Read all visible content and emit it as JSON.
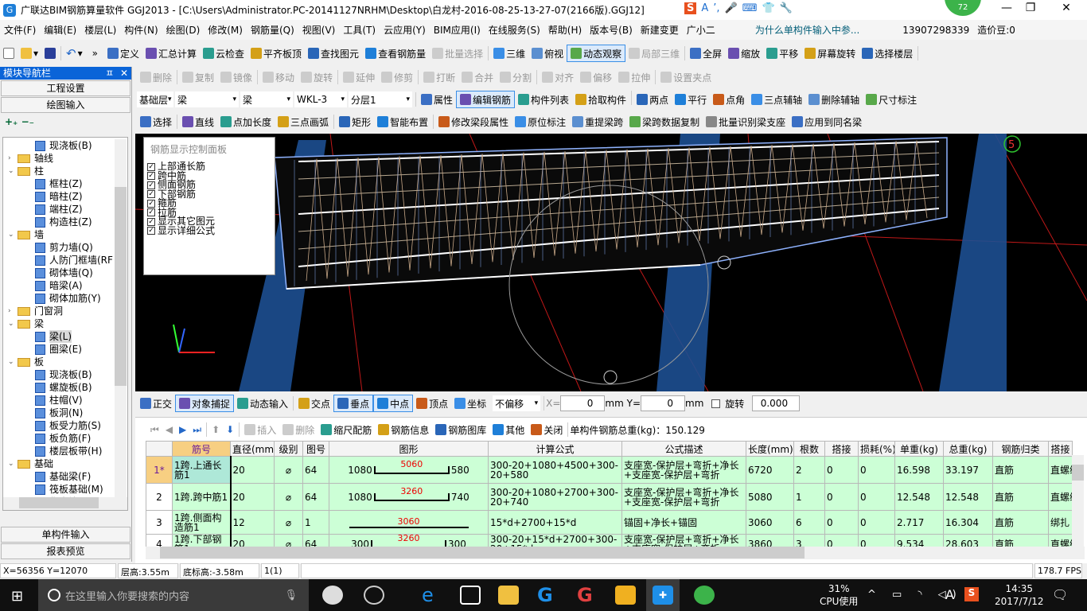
{
  "title": {
    "app_icon": "glodon-app-icon",
    "text": "广联达BIM钢筋算量软件 GGJ2013 - [C:\\Users\\Administrator.PC-20141127NRHM\\Desktop\\白龙村-2016-08-25-13-27-07(2166版).GGJ12]",
    "badge": "72",
    "ime": [
      "S",
      "A",
      "·,",
      "mic",
      "⌨",
      "15",
      "shirt",
      "wrench"
    ]
  },
  "menu": [
    "文件(F)",
    "编辑(E)",
    "楼层(L)",
    "构件(N)",
    "绘图(D)",
    "修改(M)",
    "钢筋量(Q)",
    "视图(V)",
    "工具(T)",
    "云应用(Y)",
    "BIM应用(I)",
    "在线服务(S)",
    "帮助(H)",
    "版本号(B)",
    "新建变更",
    "广小二",
    "为什么单构件输入中参...",
    "13907298339",
    "造价豆:0"
  ],
  "toolbar1": [
    "定义",
    "汇总计算",
    "云检查",
    "平齐板顶",
    "查找图元",
    "查看钢筋量",
    "批量选择",
    "三维",
    "俯视",
    "动态观察",
    "局部三维",
    "全屏",
    "缩放",
    "平移",
    "屏幕旋转",
    "选择楼层"
  ],
  "toolbar2": [
    "删除",
    "复制",
    "镜像",
    "移动",
    "旋转",
    "延伸",
    "修剪",
    "打断",
    "合并",
    "分割",
    "对齐",
    "偏移",
    "拉伸",
    "设置夹点"
  ],
  "toolbar3": {
    "combos": [
      "基础层",
      "梁",
      "梁",
      "WKL-3",
      "分层1"
    ],
    "buttons": [
      "属性",
      "编辑钢筋",
      "构件列表",
      "拾取构件",
      "两点",
      "平行",
      "点角",
      "三点辅轴",
      "删除辅轴",
      "尺寸标注"
    ]
  },
  "toolbar4": [
    "选择",
    "直线",
    "点加长度",
    "三点画弧",
    "矩形",
    "智能布置",
    "修改梁段属性",
    "原位标注",
    "重提梁跨",
    "梁跨数据复制",
    "批量识别梁支座",
    "应用到同名梁"
  ],
  "nav": {
    "title": "模块导航栏",
    "buttons": [
      "工程设置",
      "绘图输入"
    ],
    "bottom": [
      "单构件输入",
      "报表预览"
    ],
    "tree": [
      {
        "l": 2,
        "t": "现浇板(B)"
      },
      {
        "l": 1,
        "t": "轴线",
        "f": "c"
      },
      {
        "l": 1,
        "t": "柱",
        "f": "o"
      },
      {
        "l": 2,
        "t": "框柱(Z)"
      },
      {
        "l": 2,
        "t": "暗柱(Z)"
      },
      {
        "l": 2,
        "t": "端柱(Z)"
      },
      {
        "l": 2,
        "t": "构造柱(Z)"
      },
      {
        "l": 1,
        "t": "墙",
        "f": "o"
      },
      {
        "l": 2,
        "t": "剪力墙(Q)"
      },
      {
        "l": 2,
        "t": "人防门框墙(RF"
      },
      {
        "l": 2,
        "t": "砌体墙(Q)"
      },
      {
        "l": 2,
        "t": "暗梁(A)"
      },
      {
        "l": 2,
        "t": "砌体加筋(Y)"
      },
      {
        "l": 1,
        "t": "门窗洞",
        "f": "c"
      },
      {
        "l": 1,
        "t": "梁",
        "f": "o"
      },
      {
        "l": 2,
        "t": "梁(L)",
        "sel": true
      },
      {
        "l": 2,
        "t": "圈梁(E)"
      },
      {
        "l": 1,
        "t": "板",
        "f": "o"
      },
      {
        "l": 2,
        "t": "现浇板(B)"
      },
      {
        "l": 2,
        "t": "螺旋板(B)"
      },
      {
        "l": 2,
        "t": "柱帽(V)"
      },
      {
        "l": 2,
        "t": "板洞(N)"
      },
      {
        "l": 2,
        "t": "板受力筋(S)"
      },
      {
        "l": 2,
        "t": "板负筋(F)"
      },
      {
        "l": 2,
        "t": "楼层板带(H)"
      },
      {
        "l": 1,
        "t": "基础",
        "f": "o"
      },
      {
        "l": 2,
        "t": "基础梁(F)"
      },
      {
        "l": 2,
        "t": "筏板基础(M)"
      },
      {
        "l": 2,
        "t": "集水坑(K)"
      },
      {
        "l": 2,
        "t": "柱墩(Y)"
      }
    ]
  },
  "rebar_panel": {
    "title": "钢筋显示控制面板",
    "items": [
      "上部通长筋",
      "跨中筋",
      "侧面钢筋",
      "下部钢筋",
      "箍筋",
      "拉筋",
      "显示其它图元",
      "显示详细公式"
    ]
  },
  "viewport": {
    "axis_label": "5"
  },
  "snapbar": {
    "buttons": [
      "正交",
      "对象捕捉",
      "动态输入",
      "交点",
      "垂点",
      "中点",
      "顶点",
      "坐标"
    ],
    "offset": "不偏移",
    "x_label": "X=",
    "x": "0",
    "y_label": "Y=",
    "y": "0",
    "unit": "mm",
    "rotate": "旋转",
    "rotate_val": "0.000"
  },
  "rebar_toolbar": {
    "buttons": [
      "插入",
      "删除",
      "缩尺配筋",
      "钢筋信息",
      "钢筋图库",
      "其他",
      "关闭"
    ],
    "total": "单构件钢筋总重(kg)：150.129"
  },
  "table": {
    "headers": [
      "",
      "筋号",
      "直径(mm)",
      "级别",
      "图号",
      "图形",
      "计算公式",
      "公式描述",
      "长度(mm)",
      "根数",
      "搭接",
      "损耗(%)",
      "单重(kg)",
      "总重(kg)",
      "钢筋归类",
      "搭接"
    ],
    "rows": [
      {
        "rn": "1*",
        "name": "1跨.上通长筋1",
        "d": "20",
        "grade": "⌀",
        "fig": "64",
        "s": [
          "1080",
          "5060",
          "580"
        ],
        "formula": "300-20+1080+4500+300-20+580",
        "desc": "支座宽-保护层+弯折+净长+支座宽-保护层+弯折",
        "len": "6720",
        "n": "2",
        "lap": "0",
        "loss": "0",
        "uw": "16.598",
        "tw": "33.197",
        "cat": "直筋",
        "lt": "直螺纹"
      },
      {
        "rn": "2",
        "name": "1跨.跨中筋1",
        "d": "20",
        "grade": "⌀",
        "fig": "64",
        "s": [
          "1080",
          "3260",
          "740"
        ],
        "formula": "300-20+1080+2700+300-20+740",
        "desc": "支座宽-保护层+弯折+净长+支座宽-保护层+弯折",
        "len": "5080",
        "n": "1",
        "lap": "0",
        "loss": "0",
        "uw": "12.548",
        "tw": "12.548",
        "cat": "直筋",
        "lt": "直螺纹"
      },
      {
        "rn": "3",
        "name": "1跨.侧面构造筋1",
        "d": "12",
        "grade": "⌀",
        "fig": "1",
        "s": [
          "",
          "3060",
          ""
        ],
        "formula": "15*d+2700+15*d",
        "desc": "锚固+净长+锚固",
        "len": "3060",
        "n": "6",
        "lap": "0",
        "loss": "0",
        "uw": "2.717",
        "tw": "16.304",
        "cat": "直筋",
        "lt": "绑扎"
      },
      {
        "rn": "4",
        "name": "1跨.下部钢筋1",
        "d": "20",
        "grade": "⌀",
        "fig": "64",
        "s": [
          "300",
          "3260",
          "300"
        ],
        "formula": "300-20+15*d+2700+300-20+15*d",
        "desc": "支座宽-保护层+弯折+净长+支座宽-保护层+弯折",
        "len": "3860",
        "n": "3",
        "lap": "0",
        "loss": "0",
        "uw": "9.534",
        "tw": "28.603",
        "cat": "直筋",
        "lt": "直螺纹"
      }
    ]
  },
  "status": [
    "X=56356 Y=12070",
    "层高:3.55m",
    "底标高:-3.58m",
    "1(1)",
    "",
    "178.7 FPS"
  ],
  "taskbar": {
    "search": "在这里输入你要搜索的内容",
    "cpu": "31%",
    "cpu_label": "CPU使用",
    "time": "14:35",
    "date": "2017/7/12",
    "ime": "A"
  },
  "colors": {
    "accent": "#0a64d8",
    "row_bg": "#ccffd6",
    "selected_cell": "#aee8d8",
    "rownum_active": "#f7cf82",
    "viewport": "#000000",
    "column": "#1d4f91"
  }
}
